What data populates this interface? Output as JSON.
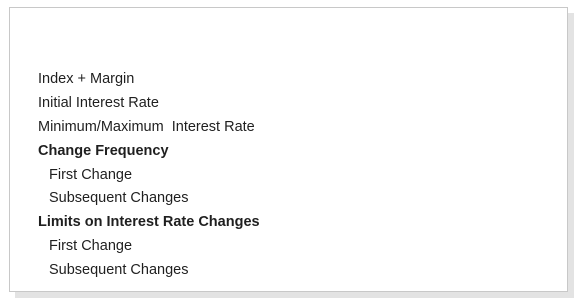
{
  "rate_terms": {
    "items": [
      {
        "label": "Index + Margin",
        "style": "normal"
      },
      {
        "label": "Initial Interest Rate",
        "style": "normal"
      },
      {
        "label": "Minimum/Maximum  Interest Rate",
        "style": "normal"
      },
      {
        "label": "Change Frequency",
        "style": "bold"
      },
      {
        "label": "First Change",
        "style": "sub"
      },
      {
        "label": "Subsequent Changes",
        "style": "sub"
      },
      {
        "label": "Limits on Interest Rate Changes",
        "style": "bold"
      },
      {
        "label": "First Change",
        "style": "sub"
      },
      {
        "label": "Subsequent Changes",
        "style": "sub"
      }
    ]
  }
}
